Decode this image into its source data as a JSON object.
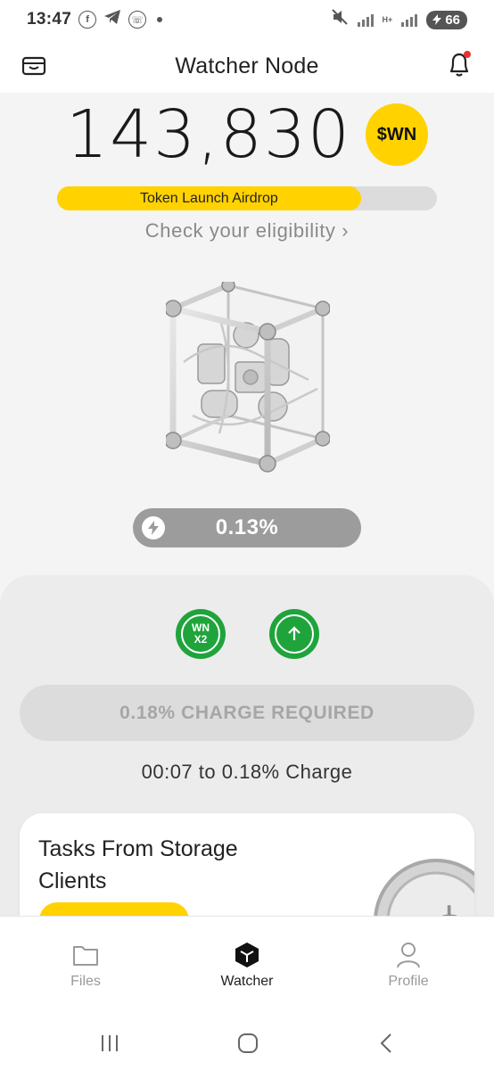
{
  "status_bar": {
    "time": "13:47",
    "battery": "66",
    "net_label_1": "H+",
    "net_label_2": "H+"
  },
  "header": {
    "title": "Watcher Node",
    "has_notification": true
  },
  "balance": {
    "value": "143,830",
    "token": "$WN"
  },
  "airdrop": {
    "label": "Token Launch Airdrop",
    "progress": 0.8
  },
  "eligibility": {
    "label": "Check your eligibility",
    "chevron": "›"
  },
  "charge": {
    "value": "0.13%"
  },
  "boosts": {
    "multiplier_line1": "WN",
    "multiplier_line2": "X2"
  },
  "charge_required": {
    "label": "0.18% CHARGE REQUIRED"
  },
  "countdown": {
    "text": "00:07 to 0.18% Charge"
  },
  "tasks": {
    "title": "Tasks From Storage Clients"
  },
  "bottom_nav": {
    "items": [
      {
        "label": "Files",
        "icon": "folder-icon",
        "active": false
      },
      {
        "label": "Watcher",
        "icon": "cube-icon",
        "active": true
      },
      {
        "label": "Profile",
        "icon": "person-icon",
        "active": false
      }
    ]
  },
  "colors": {
    "accent": "#ffd200",
    "boost_green": "#1fa43c",
    "muted": "#9c9c9c"
  }
}
